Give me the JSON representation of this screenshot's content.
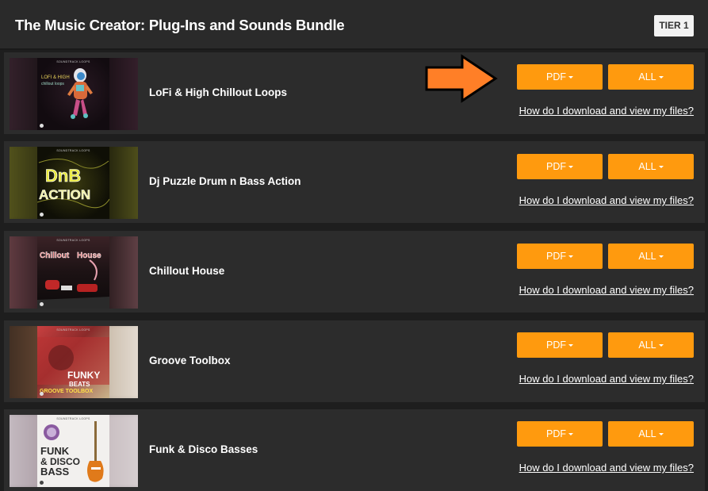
{
  "bundle": {
    "title": "The Music Creator: Plug-Ins and Sounds Bundle",
    "tier_label": "TIER 1"
  },
  "accent_color": "#ff9a0e",
  "pointer_arrow_color": "#ff7f27",
  "items": [
    {
      "name": "LoFi & High Chillout Loops",
      "cover_text": "LOFI & HIGH chillout loops",
      "pdf_label": "PDF",
      "all_label": "ALL",
      "help_link": "How do I download and view my files?"
    },
    {
      "name": "Dj Puzzle Drum n Bass Action",
      "cover_text": "DnB ACTION",
      "pdf_label": "PDF",
      "all_label": "ALL",
      "help_link": "How do I download and view my files?"
    },
    {
      "name": "Chillout House",
      "cover_text": "Chillout House",
      "pdf_label": "PDF",
      "all_label": "ALL",
      "help_link": "How do I download and view my files?"
    },
    {
      "name": "Groove Toolbox",
      "cover_text": "FUNKY BEATS GROOVE TOOLBOX",
      "pdf_label": "PDF",
      "all_label": "ALL",
      "help_link": "How do I download and view my files?"
    },
    {
      "name": "Funk & Disco Basses",
      "cover_text": "FUNK & DISCO BASS",
      "pdf_label": "PDF",
      "all_label": "ALL",
      "help_link": "How do I download and view my files?"
    }
  ],
  "cover_brand_text": "SOUNDTRACK LOOPS"
}
